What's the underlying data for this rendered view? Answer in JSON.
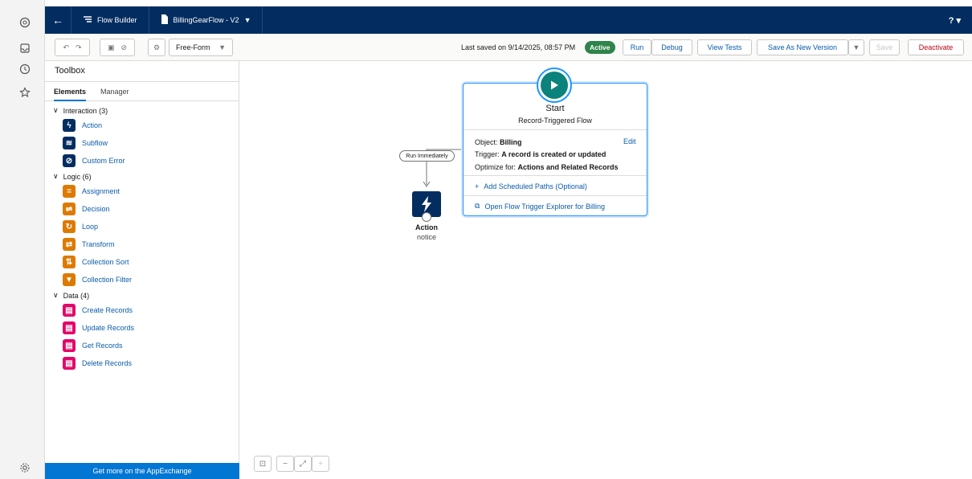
{
  "topbar": {
    "back_icon": "arrow-left-icon",
    "app_name": "Flow Builder",
    "flow_tab": "BillingGearFlow - V2",
    "help": "?"
  },
  "toolbar": {
    "mode": "Free-Form",
    "last_saved": "Last saved on 9/14/2025, 08:57 PM",
    "status": "Active",
    "run": "Run",
    "debug": "Debug",
    "view_tests": "View Tests",
    "save_new_version": "Save As New Version",
    "save": "Save",
    "deactivate": "Deactivate"
  },
  "toolbox": {
    "title": "Toolbox",
    "tab_elements": "Elements",
    "tab_manager": "Manager",
    "interaction": {
      "label": "Interaction (3)",
      "items": [
        {
          "label": "Action",
          "color": "#032d60"
        },
        {
          "label": "Subflow",
          "color": "#032d60"
        },
        {
          "label": "Custom Error",
          "color": "#032d60"
        }
      ]
    },
    "logic": {
      "label": "Logic (6)",
      "items": [
        {
          "label": "Assignment",
          "color": "#dd7a01"
        },
        {
          "label": "Decision",
          "color": "#dd7a01"
        },
        {
          "label": "Loop",
          "color": "#dd7a01"
        },
        {
          "label": "Transform",
          "color": "#dd7a01"
        },
        {
          "label": "Collection Sort",
          "color": "#dd7a01"
        },
        {
          "label": "Collection Filter",
          "color": "#dd7a01"
        }
      ]
    },
    "data": {
      "label": "Data (4)",
      "items": [
        {
          "label": "Create Records",
          "color": "#e3066a"
        },
        {
          "label": "Update Records",
          "color": "#e3066a"
        },
        {
          "label": "Get Records",
          "color": "#e3066a"
        },
        {
          "label": "Delete Records",
          "color": "#e3066a"
        }
      ]
    },
    "appexchange": "Get more on the AppExchange"
  },
  "canvas": {
    "start": {
      "title": "Start",
      "subtitle": "Record-Triggered Flow",
      "object_label": "Object:",
      "object_value": "Billing",
      "edit": "Edit",
      "trigger_label": "Trigger:",
      "trigger_value": "A record is created or updated",
      "optimize_label": "Optimize for:",
      "optimize_value": "Actions and Related Records",
      "add_paths": "Add Scheduled Paths (Optional)",
      "open_explorer": "Open Flow Trigger Explorer for Billing"
    },
    "run_immediately": "Run Immediately",
    "action_node": {
      "label": "Action",
      "sublabel": "notice"
    }
  },
  "colors": {
    "navy": "#032d60",
    "brand_blue": "#0176d3",
    "active_green": "#2e844a",
    "start_teal": "#0b827c"
  }
}
